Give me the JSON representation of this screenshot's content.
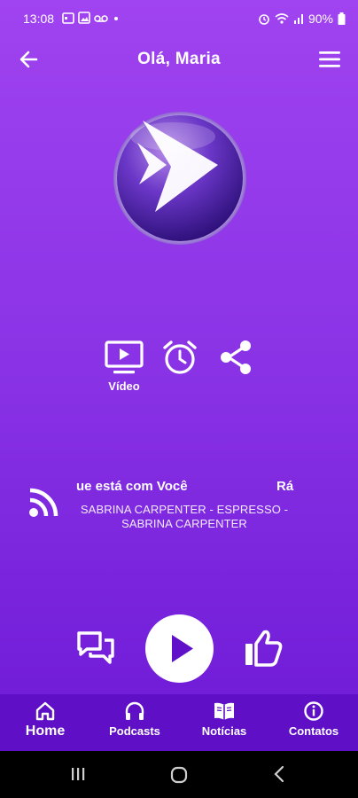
{
  "status_bar": {
    "time": "13:08",
    "battery": "90%",
    "left_icons": [
      "calendar-icon",
      "photo-icon",
      "voicemail-icon",
      "dot-icon"
    ],
    "right_icons": [
      "alarm-icon",
      "wifi-icon",
      "signal-icon",
      "battery-icon"
    ]
  },
  "header": {
    "title": "Olá, Maria"
  },
  "actions": {
    "video_label": "Vídeo"
  },
  "now_playing": {
    "ticker_a": "ue está com Você",
    "ticker_b": "Rá",
    "track_info": "SABRINA CARPENTER - ESPRESSO - SABRINA CARPENTER"
  },
  "bottom_nav": {
    "items": [
      {
        "label": "Home",
        "icon": "home-icon"
      },
      {
        "label": "Podcasts",
        "icon": "headphones-icon"
      },
      {
        "label": "Notícias",
        "icon": "book-icon"
      },
      {
        "label": "Contatos",
        "icon": "info-icon"
      }
    ]
  },
  "colors": {
    "background_top": "#a043f0",
    "background_bottom": "#6a16d4",
    "nav_background": "#5f0fc5",
    "accent": "#5f10c8"
  }
}
